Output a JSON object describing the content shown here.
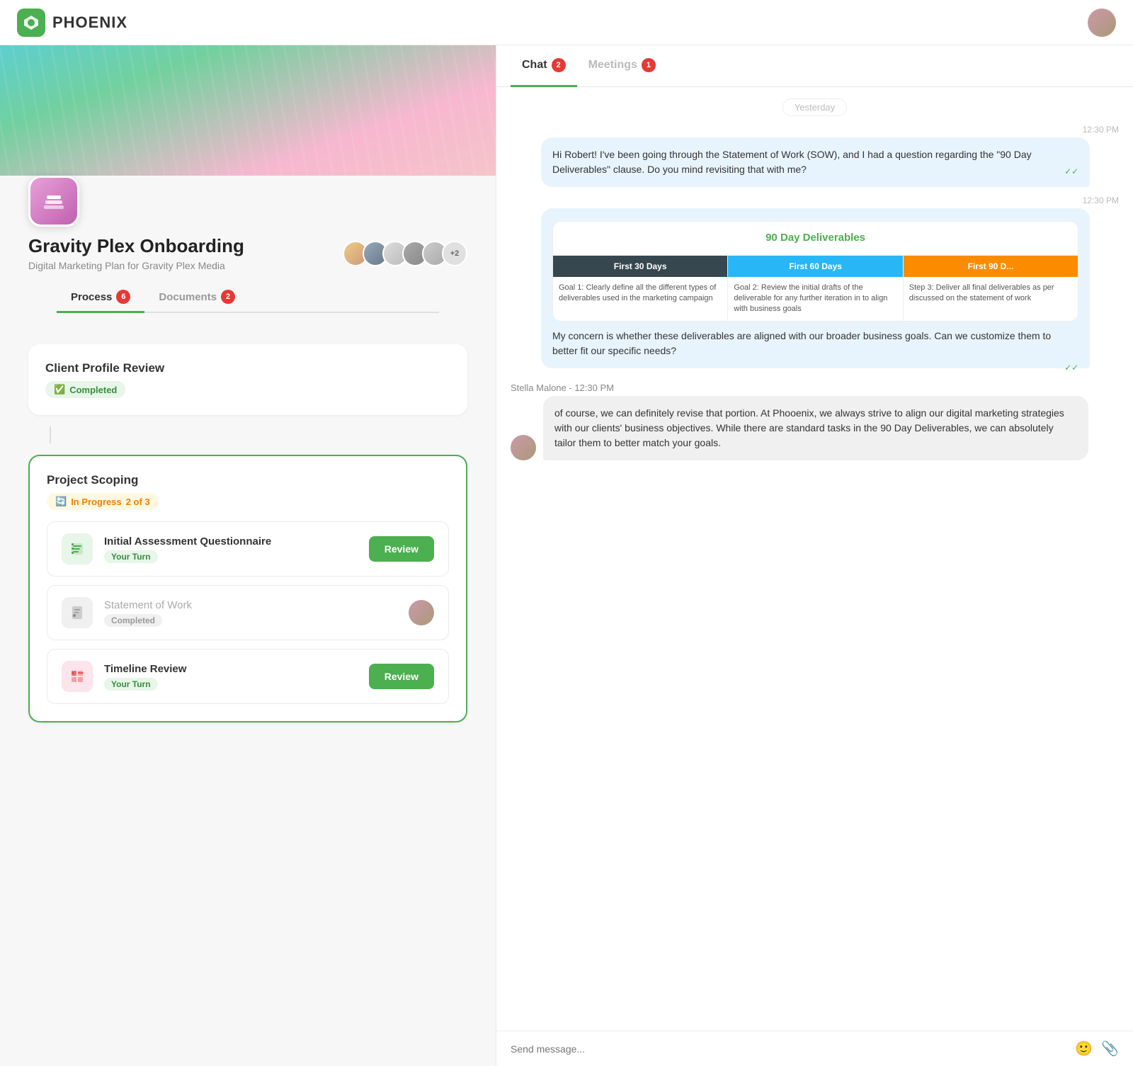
{
  "app": {
    "name": "PHOENIX",
    "logo_alt": "Phoenix logo"
  },
  "project": {
    "title": "Gravity Plex Onboarding",
    "subtitle": "Digital Marketing Plan for Gravity Plex Media",
    "tabs": [
      {
        "label": "Process",
        "badge": "6",
        "active": true
      },
      {
        "label": "Documents",
        "badge": "2",
        "active": false
      }
    ],
    "avatar_group": [
      {
        "initials": "",
        "color": "#ec407a"
      },
      {
        "initials": "",
        "color": "#8d6e63"
      },
      {
        "initials": "",
        "color": "#5c6bc0"
      },
      {
        "initials": "",
        "color": "#9e9e9e"
      },
      {
        "initials": "",
        "color": "#607d8b"
      }
    ],
    "avatar_extra": "+2"
  },
  "sections": [
    {
      "id": "client-profile",
      "title": "Client Profile Review",
      "status": "Completed",
      "status_type": "completed",
      "active": false
    },
    {
      "id": "project-scoping",
      "title": "Project Scoping",
      "status": "In Progress",
      "status_detail": "2 of 3",
      "status_type": "inprogress",
      "active": true,
      "tasks": [
        {
          "name": "Initial Assessment Questionnaire",
          "sub": "Your Turn",
          "sub_type": "green",
          "icon_type": "green",
          "action": "Review"
        },
        {
          "name": "Statement of Work",
          "sub": "Completed",
          "sub_type": "gray",
          "icon_type": "gray",
          "action": null,
          "has_avatar": true
        },
        {
          "name": "Timeline Review",
          "sub": "Your Turn",
          "sub_type": "green",
          "icon_type": "red",
          "action": "Review"
        }
      ]
    }
  ],
  "chat": {
    "tabs": [
      {
        "label": "Chat",
        "badge": "2",
        "active": true
      },
      {
        "label": "Meetings",
        "badge": "1",
        "active": false
      }
    ],
    "messages": [
      {
        "type": "date",
        "value": "Yesterday"
      },
      {
        "type": "outgoing",
        "time": "12:30 PM",
        "text": "Hi Robert! I've been going through the Statement of Work (SOW), and I had a question regarding the \"90 Day Deliverables\" clause. Do you mind revisiting that with me?",
        "double_check": true
      },
      {
        "type": "outgoing_card",
        "time": "12:30 PM",
        "card_title": "90 Day Deliverables",
        "columns": [
          {
            "header": "First 30 Days",
            "header_color": "dark",
            "body": "Goal 1: Clearly define all the different types of deliverables used in the marketing campaign"
          },
          {
            "header": "First 60 Days",
            "header_color": "blue",
            "body": "Goal 2: Review the initial drafts of the deliverable for any further iteration in to align with business goals"
          },
          {
            "header": "First 90 D...",
            "header_color": "orange",
            "body": "Step 3: Deliver all final deliverables as per discussed on the statement of work"
          }
        ],
        "follow_text": "My concern is whether these deliverables are aligned with our broader business goals. Can we customize them to better fit our specific needs?",
        "double_check": true
      },
      {
        "type": "incoming",
        "sender": "Stella Malone",
        "time": "12:30 PM",
        "text": "of course, we can definitely revise that portion. At Phooenix, we always strive to align our digital marketing strategies with our clients' business objectives. While there are standard tasks in the 90 Day Deliverables, we can absolutely tailor them to better match your goals."
      }
    ],
    "input_placeholder": "Send message..."
  }
}
